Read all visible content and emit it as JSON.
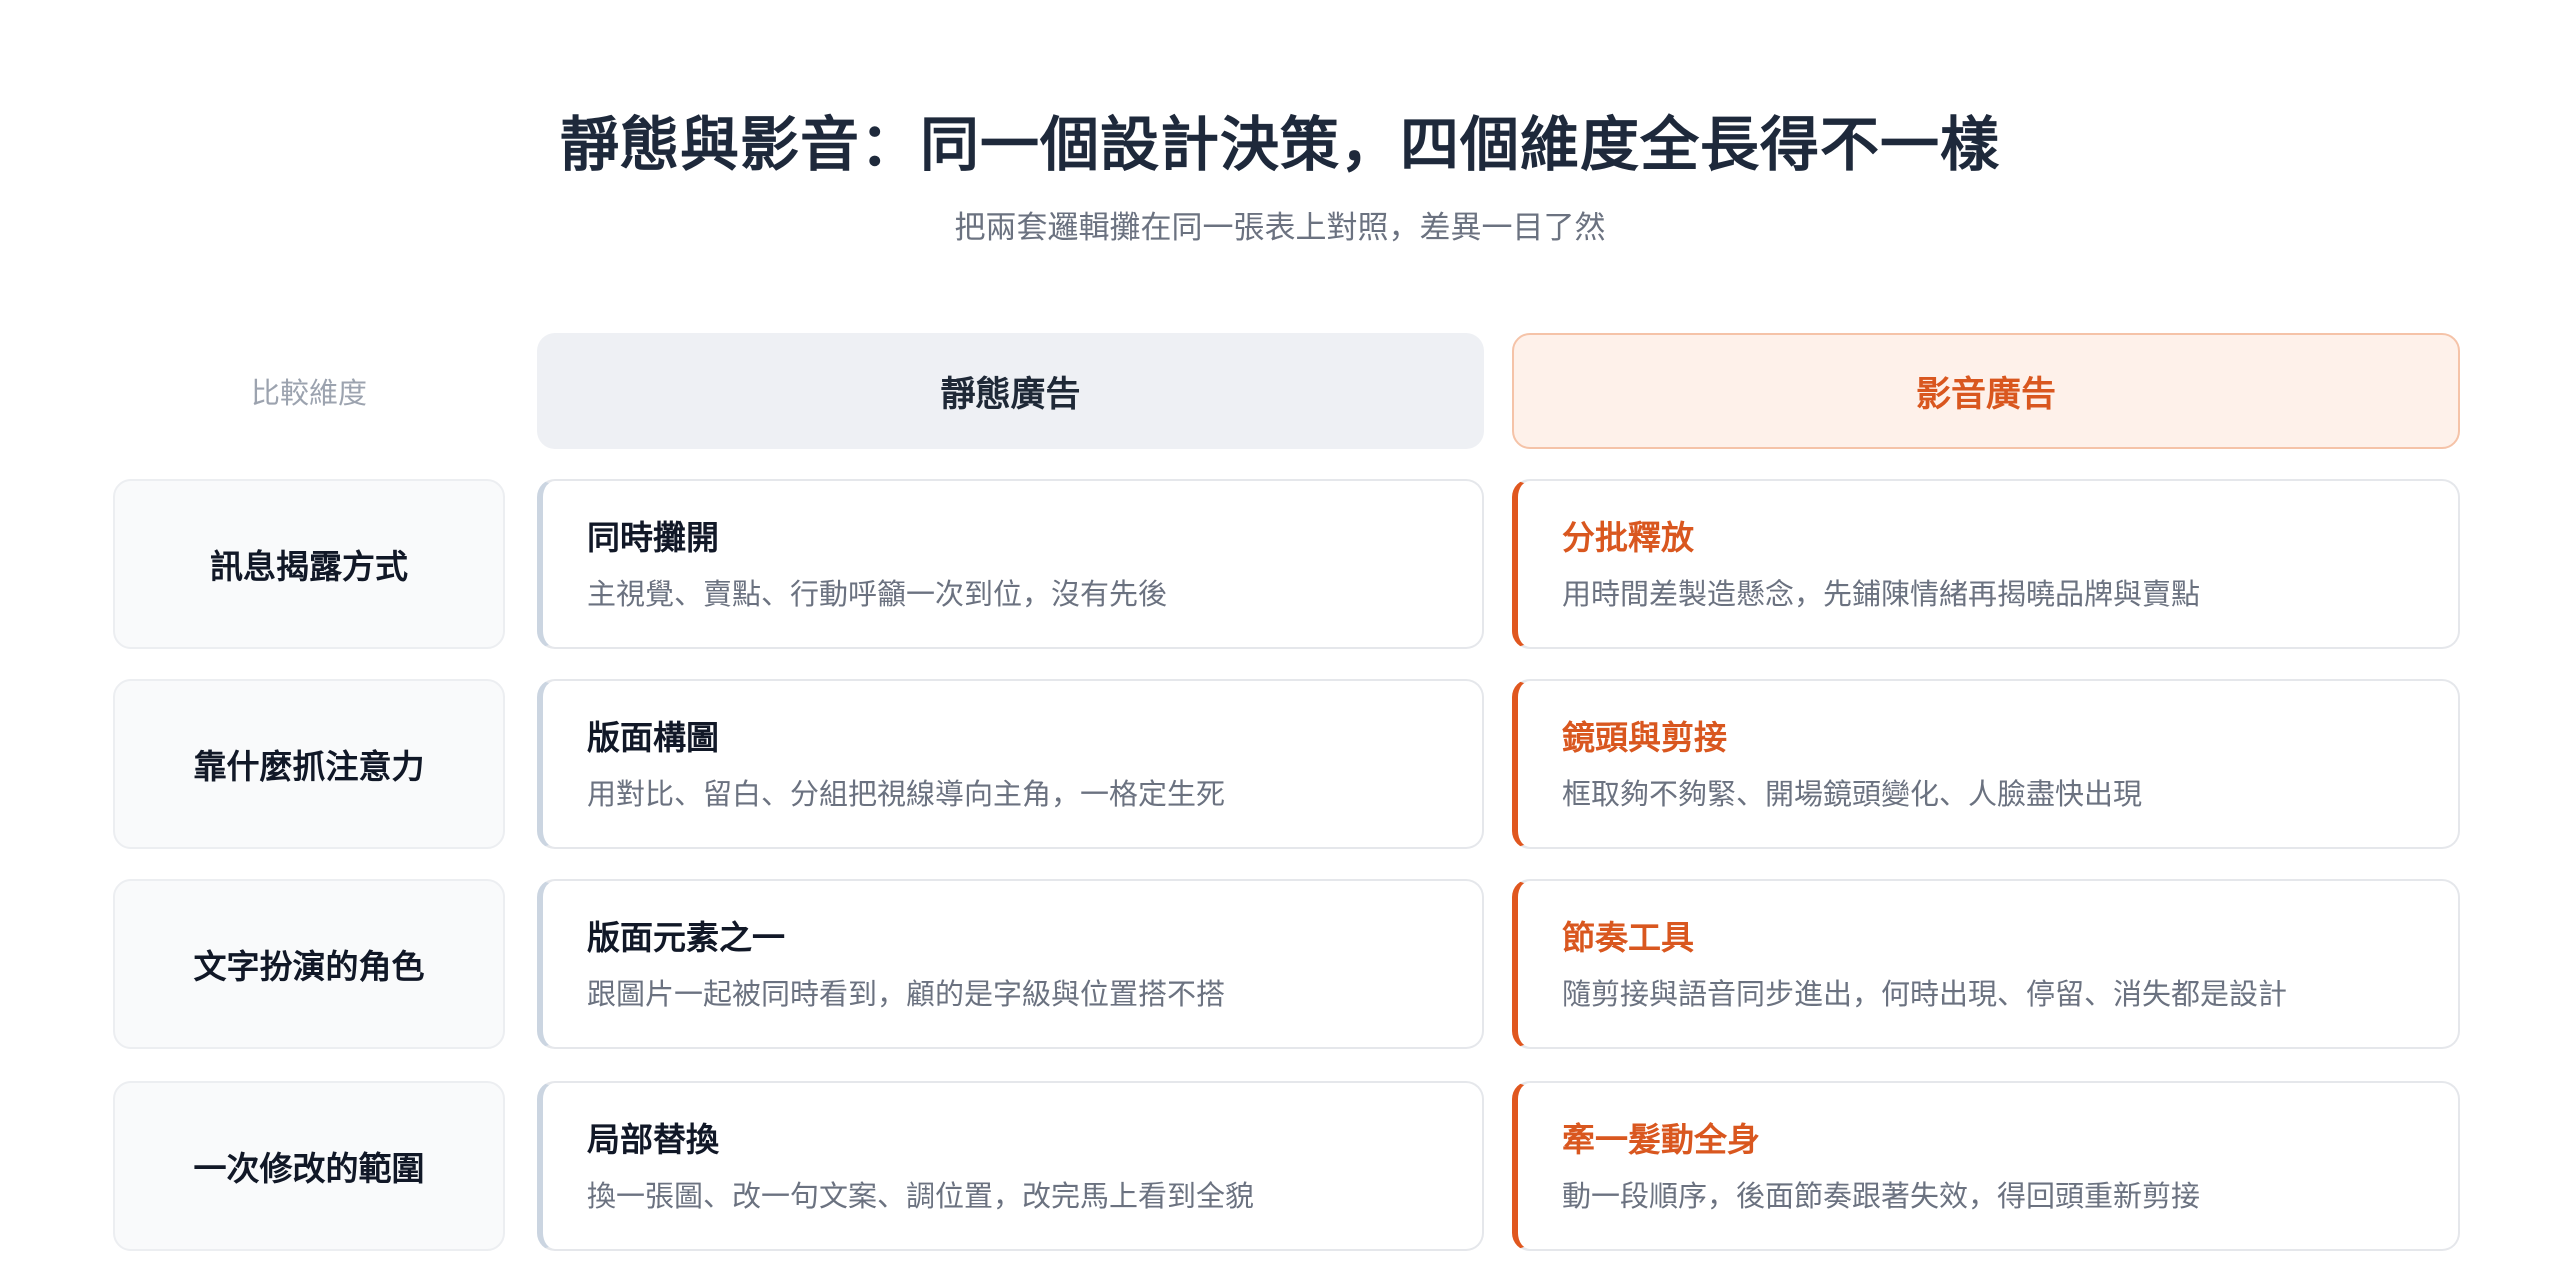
{
  "header": {
    "title": "靜態與影音：同一個設計決策，四個維度全長得不一樣",
    "subtitle": "把兩套邏輯攤在同一張表上對照，差異一目了然"
  },
  "columns": {
    "dimension_label": "比較維度",
    "static_label": "靜態廣告",
    "video_label": "影音廣告"
  },
  "colors": {
    "accent": "#d9571f",
    "static_bar": "#cbd5e1",
    "video_header_bg": "#fef1ea"
  },
  "rows": [
    {
      "dimension": "訊息揭露方式",
      "static": {
        "title": "同時攤開",
        "desc": "主視覺、賣點、行動呼籲一次到位，沒有先後"
      },
      "video": {
        "title": "分批釋放",
        "desc": "用時間差製造懸念，先鋪陳情緒再揭曉品牌與賣點"
      }
    },
    {
      "dimension": "靠什麼抓注意力",
      "static": {
        "title": "版面構圖",
        "desc": "用對比、留白、分組把視線導向主角，一格定生死"
      },
      "video": {
        "title": "鏡頭與剪接",
        "desc": "框取夠不夠緊、開場鏡頭變化、人臉盡快出現"
      }
    },
    {
      "dimension": "文字扮演的角色",
      "static": {
        "title": "版面元素之一",
        "desc": "跟圖片一起被同時看到，顧的是字級與位置搭不搭"
      },
      "video": {
        "title": "節奏工具",
        "desc": "隨剪接與語音同步進出，何時出現、停留、消失都是設計"
      }
    },
    {
      "dimension": "一次修改的範圍",
      "static": {
        "title": "局部替換",
        "desc": "換一張圖、改一句文案、調位置，改完馬上看到全貌"
      },
      "video": {
        "title": "牽一髮動全身",
        "desc": "動一段順序，後面節奏跟著失效，得回頭重新剪接"
      }
    }
  ]
}
